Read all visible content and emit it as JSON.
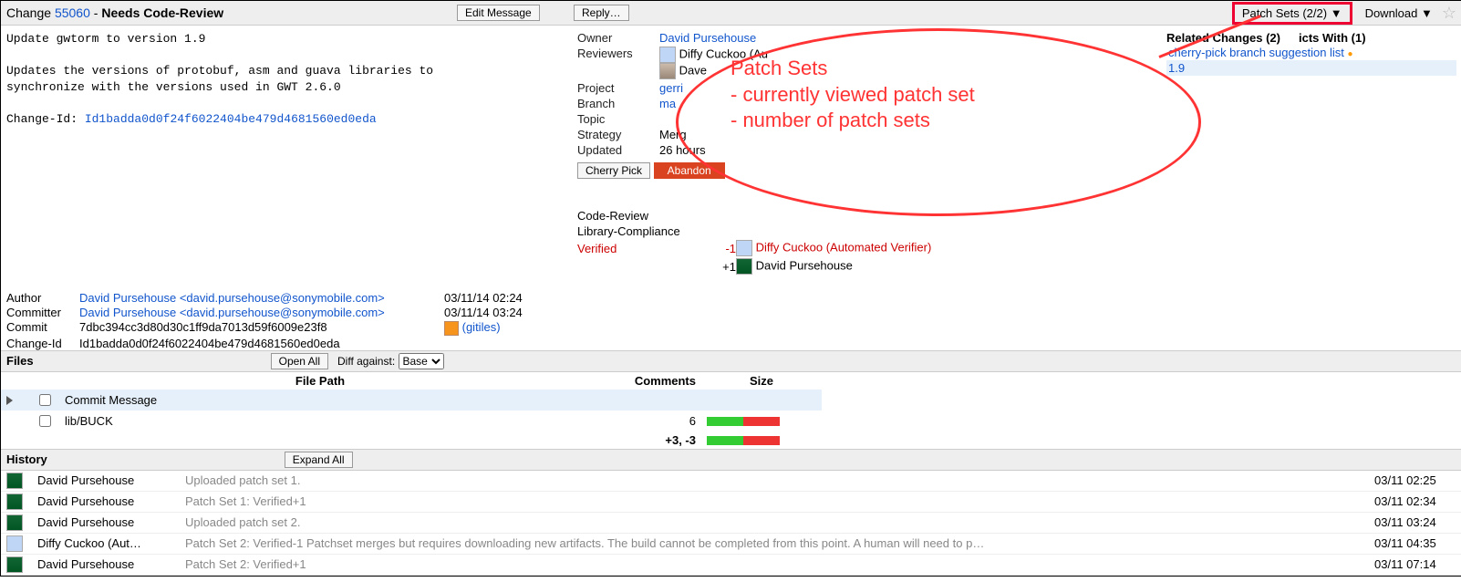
{
  "header": {
    "change_prefix": "Change ",
    "change_number": "55060",
    "status_sep": " - ",
    "status": "Needs Code-Review",
    "edit_message": "Edit Message",
    "reply": "Reply…",
    "patch_sets": "Patch Sets (2/2) ▼",
    "download": "Download ▼"
  },
  "commit_msg": {
    "l1": "Update gwtorm to version 1.9",
    "l2": "",
    "l3": "Updates the versions of protobuf, asm and guava libraries to",
    "l4": "synchronize with the versions used in GWT 2.6.0",
    "l5": "",
    "l6_pre": "Change-Id: ",
    "l6_id": "Id1badda0d0f24f6022404be479d4681560ed0eda"
  },
  "meta": {
    "author_k": "Author",
    "author_v": "David Pursehouse <david.pursehouse@sonymobile.com>",
    "author_d": "03/11/14 02:24",
    "committer_k": "Committer",
    "committer_v": "David Pursehouse <david.pursehouse@sonymobile.com>",
    "committer_d": "03/11/14 03:24",
    "commit_k": "Commit",
    "commit_v": "7dbc394cc3d80d30c1ff9da7013d59f6009e23f8",
    "gitiles": "(gitiles)",
    "changeid_k": "Change-Id",
    "changeid_v": "Id1badda0d0f24f6022404be479d4681560ed0eda"
  },
  "mid": {
    "owner_k": "Owner",
    "owner_v": "David Pursehouse",
    "reviewers_k": "Reviewers",
    "rev1": "Diffy Cuckoo (Au",
    "rev2": "Dave ",
    "project_k": "Project",
    "project_v": "gerri",
    "branch_k": "Branch",
    "branch_v": "ma",
    "topic_k": "Topic",
    "strategy_k": "Strategy",
    "strategy_v": "Merg",
    "updated_k": "Updated",
    "updated_v": "26 hours",
    "cherry_pick": "Cherry Pick",
    "abandon": "Abandon"
  },
  "labels": {
    "cr": "Code-Review",
    "lc": "Library-Compliance",
    "ver": "Verified",
    "neg1": "-1",
    "ver_neg_who": "Diffy Cuckoo (Automated Verifier)",
    "pos1": "+1",
    "ver_pos_who": "David Pursehouse"
  },
  "related": {
    "title_a": "Related Changes (2)",
    "title_b": "icts With (1)",
    "r1": "cherry-pick branch suggestion list",
    "r2": "1.9"
  },
  "files": {
    "section": "Files",
    "open_all": "Open All",
    "diff_against": "Diff against:",
    "base": "Base",
    "h_path": "File Path",
    "h_comments": "Comments",
    "h_size": "Size",
    "f1": "Commit Message",
    "f2": "lib/BUCK",
    "f2_comments": "6",
    "totals": "+3, -3"
  },
  "history": {
    "section": "History",
    "expand_all": "Expand All",
    "rows": [
      {
        "who": "David Pursehouse",
        "msg": "Uploaded patch set 1.",
        "when": "03/11 02:25",
        "av": "green"
      },
      {
        "who": "David Pursehouse",
        "msg": "Patch Set 1: Verified+1",
        "when": "03/11 02:34",
        "av": "green"
      },
      {
        "who": "David Pursehouse",
        "msg": "Uploaded patch set 2.",
        "when": "03/11 03:24",
        "av": "green"
      },
      {
        "who": "Diffy Cuckoo (Aut…",
        "msg": "Patch Set 2: Verified-1 Patchset merges but requires downloading new artifacts. The build cannot be completed from this point. A human will need to p…",
        "when": "03/11 04:35",
        "av": "diffy"
      },
      {
        "who": "David Pursehouse",
        "msg": "Patch Set 2: Verified+1",
        "when": "03/11 07:14",
        "av": "green"
      }
    ]
  },
  "annotation": {
    "l1": "Patch Sets",
    "l2": "- currently viewed patch set",
    "l3": "- number of patch sets"
  }
}
